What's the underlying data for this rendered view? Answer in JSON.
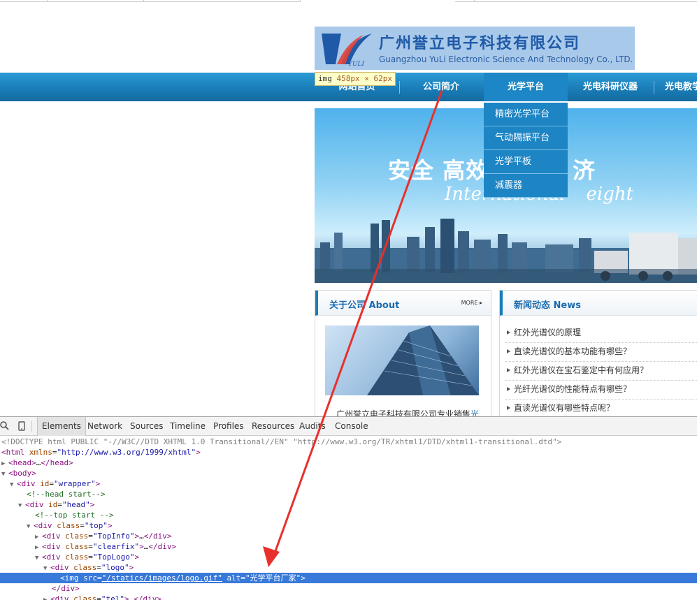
{
  "logo": {
    "name_cn": "广州誉立电子科技有限公司",
    "name_en": "Guangzhou YuLi Electronic Science And Technology Co., LTD.",
    "mark_text": "YULI"
  },
  "tooltip": {
    "tag": "img",
    "dimensions": "458px × 62px"
  },
  "nav": {
    "items": [
      "网站首页",
      "公司简介",
      "光学平台",
      "光电科研仪器",
      "光电教学"
    ],
    "dropdown": [
      "精密光学平台",
      "气动隔振平台",
      "光学平板",
      "减震器"
    ]
  },
  "banner": {
    "title": "安全 高效",
    "title_tail": "济",
    "subtitle": "International",
    "subtitle_tail": "eight"
  },
  "about": {
    "title": "关于公司 About",
    "more": "MORE",
    "text": "广州誉立电子科技有限公司专业销售",
    "text_highlight": "光"
  },
  "news": {
    "title": "新闻动态 News",
    "items": [
      "红外光谱仪的原理",
      "直读光谱仪的基本功能有哪些？",
      "红外光谱仪在宝石鉴定中有何应用？",
      "光纤光谱仪的性能特点有哪些？",
      "直读光谱仪有哪些特点呢？"
    ]
  },
  "devtools": {
    "tabs": [
      "Elements",
      "Network",
      "Sources",
      "Timeline",
      "Profiles",
      "Resources",
      "Audits",
      "Console"
    ],
    "active_tab": "Elements",
    "doctype": "<!DOCTYPE html PUBLIC \"-//W3C//DTD XHTML 1.0 Transitional//EN\" \"http://www.w3.org/TR/xhtml1/DTD/xhtml1-transitional.dtd\">",
    "html_attr": "xmlns",
    "html_val": "\"http://www.w3.org/1999/xhtml\"",
    "comment_head": "<!--head start-->",
    "comment_top": "<!--top start -->",
    "ellipsis": "…",
    "id_wrapper": "\"wrapper\"",
    "id_head": "\"head\"",
    "class_top": "\"top\"",
    "class_topinfo": "\"TopInfo\"",
    "class_clearfix": "\"clearfix\"",
    "class_toplogo": "\"TopLogo\"",
    "class_logo": "\"logo\"",
    "class_tel": "\"tel\"",
    "img_src": "\"/statics/images/logo.gif\"",
    "img_alt": "\"光学平台厂家\""
  },
  "colors": {
    "nav": "#1a7db8",
    "selection": "#3879d9",
    "arrow": "#e8302c"
  }
}
